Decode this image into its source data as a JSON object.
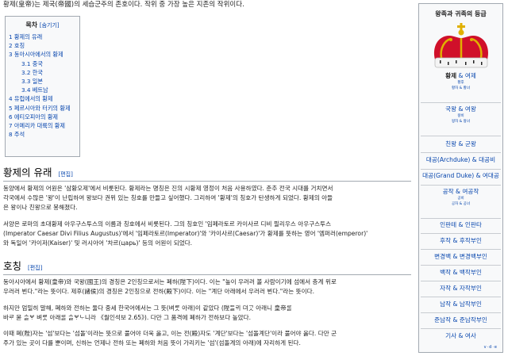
{
  "intro": {
    "line": "황제(皇帝)는 제국(帝國)의 세습군주의 존호이다. 작위 중 가장 높은 지존의 작위이다."
  },
  "toc": {
    "title": "목차",
    "hide_label": "[숨기기]",
    "items": [
      "1 황제의 유래",
      "2 호칭",
      "3 동아시아에서의 황제",
      "3.1 중국",
      "3.2 한국",
      "3.3 일본",
      "3.4 베트남",
      "4 유럽에서의 황제",
      "5 페르시아와 터키의 황제",
      "6 에티오피아의 황제",
      "7 아메리카 대륙의 황제",
      "8 주석"
    ]
  },
  "sections": {
    "origin": {
      "title": "황제의 유래",
      "edit": "[편집]",
      "para1": [
        "동양에서 황제의 어원은 '삼황오제'에서 비롯된다. 황제라는 명칭은 진의 시황제 영정이 처음 사용하였다. 춘추 전국 시대를 거치면서",
        "각국에서 수많은 '왕'이 난립하여 왕보다 권위 있는 칭호를 만들고 싶어했다. 그리하여 '황제'의 칭호가 탄생하게 되었다. 황제의 아들",
        "은 왕이나 친왕으로 봉해졌다."
      ],
      "para2": [
        "서양은 로마의 초대황제 아우구스투스의 이름과 칭호에서 비롯된다. 그의 칭호인 '임페라토르 카이사르 디비 필리우스 아우구스투스",
        "(Imperator Caesar Divi Filius Augustus)'에서 '임페라토르(Imperator)'와 '카이사르(Caesar)'가 황제를 뜻하는 영어 '엠퍼러(emperor)'",
        "와 독일어 '카이저(Kaiser)' 및 러시아어 '차르(царь)' 등의 어원이 되었다."
      ]
    },
    "title_usage": {
      "title": "호칭",
      "edit": "[편집]",
      "para1": [
        "동아시아에서 황제(皇帝)와 국왕(國王)의 경칭은 2인칭으로서는 폐하(陛下)이다. 이는 \"높이 우러러 볼 사람이기에 섬에서 층계 위로",
        "우러러 뵌다.\"라는 뜻이다. 제후(諸侯)의 경칭은 2인칭으로 전하(殿下)이다. 이는 \"계단 아래에서 우러러 뵌다.\"라는 뜻이다."
      ],
      "para2": [
        "하지만 엄밀히 말해, 폐하와 전하는 둘다 중세 한국어에서는 그 뜻(벼ᄅᆞᆺ 아래)이 같았다 (陛ᄃᆞᆯᄅᆡ 뎌ᄀᆞᆺ 아래니 皇帝ᄅᆞᆯ",
        "바ᄅᆞ 몯 ᄉᆞᆯᄫᆞ 벼ᄅᆞᆺ 아래ᄅᆞᆯ ᄉᆞᆯᄫᆞᄂᆞ니라 《월인석보 2.65》). 다만 그 품격에 폐하가 전하보다 높았다."
      ],
      "para3": [
        "이때 폐(陛)자는 '섬'보다는 '섬돌'이라는 뜻으로 풀어야 더욱 옳고, 이는 전(殿)자도 '계단'보다는 '섬돌계단'이라 풀어야 옳다. 다만 군",
        "주가 있는 곳이 다를 뿐이며, 신하는 언제나 전하 또는 폐하와 처음 뜻이 가리키는 '섬'(섬돌계의 아래)에 자리하게 된다."
      ]
    }
  },
  "infobox": {
    "title": "왕족과 귀족의 등급",
    "ranks": [
      {
        "main": "황제",
        "rest": " & 여제",
        "sub1": "황후",
        "sub2": "황자 & 황녀"
      },
      {
        "main": "국왕 & 여왕",
        "sub1": "왕비",
        "sub2": "왕자 & 왕녀"
      },
      {
        "main": "친왕 & 군왕"
      },
      {
        "main": "대공(Archduke) & 대공비"
      },
      {
        "main": "대공(Grand Duke) & 여대공"
      },
      {
        "main": "공작 & 여공작",
        "sub1": "공비",
        "sub2": "공자 & 공녀"
      },
      {
        "main": "인판테 & 인판타"
      },
      {
        "main": "후작 & 후작부인"
      },
      {
        "main": "변경백 & 변경백부인"
      },
      {
        "main": "백작 & 백작부인"
      },
      {
        "main": "자작 & 자작부인"
      },
      {
        "main": "남작 & 남작부인"
      },
      {
        "main": "준남작 & 준남작부인"
      },
      {
        "main": "기사 & 여사"
      }
    ],
    "vde": "v·d·e"
  },
  "colors": {
    "link": "#0645ad",
    "crown_red": "#d0102a",
    "crown_gold": "#e0b000",
    "ermine": "#f4f4f4"
  }
}
